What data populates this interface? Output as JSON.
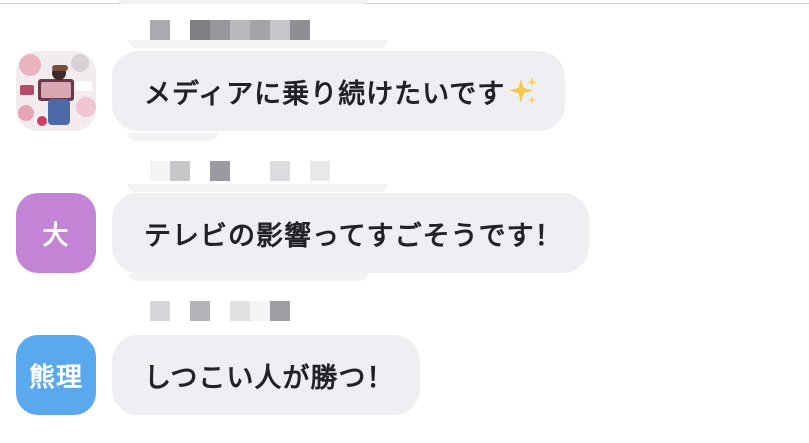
{
  "messages": [
    {
      "avatar": {
        "kind": "photo",
        "icon": "photo-avatar-icon",
        "text": ""
      },
      "text": "メディアに乗り続けたいです",
      "emoji": "sparkles-icon",
      "name_mosaic": [
        "#a9a9ae",
        "#ffffff",
        "#7e7e84",
        "#97979d",
        "#b8b8bd",
        "#a3a3a8",
        "#c6c6ca",
        "#8e8e94"
      ]
    },
    {
      "avatar": {
        "kind": "text",
        "text": "大",
        "color": "#c384d6"
      },
      "text": "テレビの影響ってすごそうです！",
      "name_mosaic": [
        "#f4f4f6",
        "#c7c7cb",
        "#ffffff",
        "#9a9aa0",
        "#ffffff",
        "#ffffff",
        "#dcdce0",
        "#ffffff",
        "#e9e9ec"
      ]
    },
    {
      "avatar": {
        "kind": "text",
        "text": "熊理",
        "color": "#5aa9ee"
      },
      "text": "しつこい人が勝つ！",
      "name_mosaic": [
        "#d6d6da",
        "#ffffff",
        "#b3b3b8",
        "#ffffff",
        "#e0e0e3",
        "#f4f4f6",
        "#9d9da3"
      ]
    }
  ],
  "colors": {
    "bubble": "#efeff3",
    "text": "#222226",
    "background": "#ffffff"
  }
}
